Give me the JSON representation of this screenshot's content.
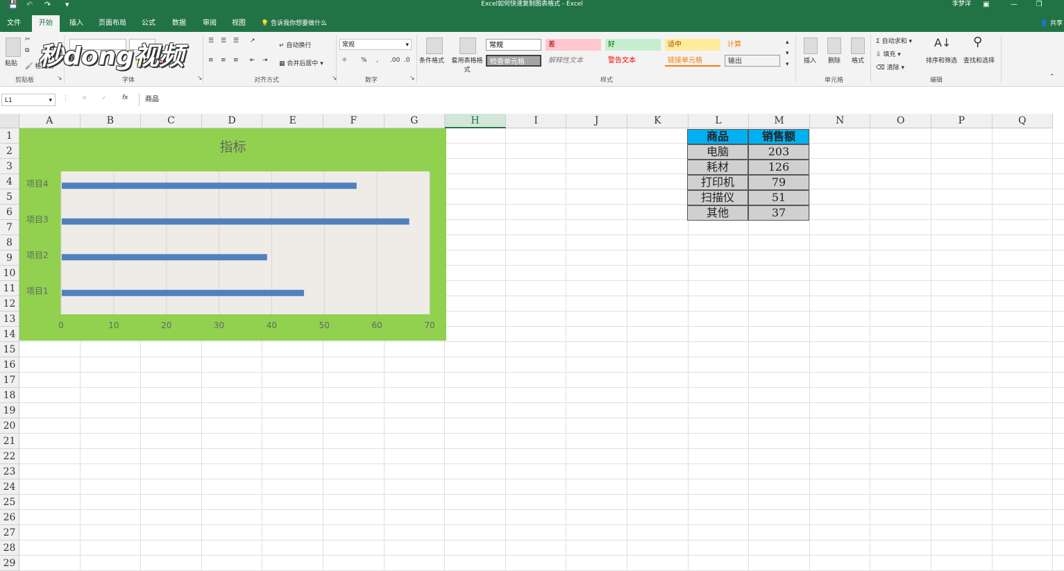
{
  "window": {
    "title": "Excel如何快速复制图表格式 - Excel",
    "user": "李梦洋"
  },
  "tabs": [
    "文件",
    "开始",
    "插入",
    "页面布局",
    "公式",
    "数据",
    "审阅",
    "视图"
  ],
  "active_tab": "开始",
  "tell_me": "告诉我你想要做什么",
  "share_label": "共享",
  "ribbon": {
    "groups": [
      "剪贴板",
      "字体",
      "对齐方式",
      "数字",
      "样式",
      "单元格",
      "编辑"
    ],
    "clipboard": {
      "paste": "粘贴",
      "format_painter": "格式刷"
    },
    "alignment": {
      "wrap": "自动换行",
      "merge": "合并后居中"
    },
    "number_format": "常规",
    "conditional": "条件格式",
    "table_format": "套用表格格式",
    "styles": [
      {
        "name": "常规",
        "bg": "#ffffff",
        "fg": "#000000"
      },
      {
        "name": "差",
        "bg": "#ffc7ce",
        "fg": "#9c0006"
      },
      {
        "name": "好",
        "bg": "#c6efce",
        "fg": "#006100"
      },
      {
        "name": "适中",
        "bg": "#ffeb9c",
        "fg": "#9c5700"
      },
      {
        "name": "计算",
        "bg": "#f2f2f2",
        "fg": "#fa7d00"
      },
      {
        "name": "检查单元格",
        "bg": "#a5a5a5",
        "fg": "#ffffff"
      },
      {
        "name": "解释性文本",
        "bg": "#f3f3f3",
        "fg": "#7f7f7f"
      },
      {
        "name": "警告文本",
        "bg": "#f3f3f3",
        "fg": "#ff0000"
      },
      {
        "name": "链接单元格",
        "bg": "#f3f3f3",
        "fg": "#fa7d00"
      },
      {
        "name": "输出",
        "bg": "#f2f2f2",
        "fg": "#3f3f3f"
      }
    ],
    "cells": {
      "insert": "插入",
      "delete": "删除",
      "format": "格式"
    },
    "editing": {
      "autosum": "自动求和",
      "fill": "填充",
      "clear": "清除",
      "sort": "排序和筛选",
      "find": "查找和选择"
    }
  },
  "watermark": "秒dong视频",
  "formula_bar": {
    "name_box": "L1",
    "content": "商品"
  },
  "columns": [
    "A",
    "B",
    "C",
    "D",
    "E",
    "F",
    "G",
    "H",
    "I",
    "J",
    "K",
    "L",
    "M",
    "N",
    "O",
    "P",
    "Q"
  ],
  "rows": [
    "1",
    "2",
    "3",
    "4",
    "5",
    "6",
    "7",
    "8",
    "9",
    "10",
    "11",
    "12",
    "13",
    "14",
    "15",
    "16",
    "17",
    "18",
    "19",
    "20",
    "21",
    "22",
    "23",
    "24",
    "25",
    "26",
    "27",
    "28",
    "29"
  ],
  "chart_data": {
    "type": "bar",
    "orientation": "horizontal",
    "title": "指标",
    "categories": [
      "项目4",
      "项目3",
      "项目2",
      "项目1"
    ],
    "values": [
      56,
      66,
      39,
      46
    ],
    "xlim": [
      0,
      70
    ],
    "xticks": [
      "0",
      "10",
      "20",
      "30",
      "40",
      "50",
      "60",
      "70"
    ],
    "grid": true,
    "bar_color": "#4f81bd",
    "plot_bg": "#efebe7",
    "chart_bg": "#92d050"
  },
  "table": {
    "headers": [
      "商品",
      "销售额"
    ],
    "rows": [
      [
        "电脑",
        "203"
      ],
      [
        "耗材",
        "126"
      ],
      [
        "打印机",
        "79"
      ],
      [
        "扫描仪",
        "51"
      ],
      [
        "其他",
        "37"
      ]
    ]
  }
}
